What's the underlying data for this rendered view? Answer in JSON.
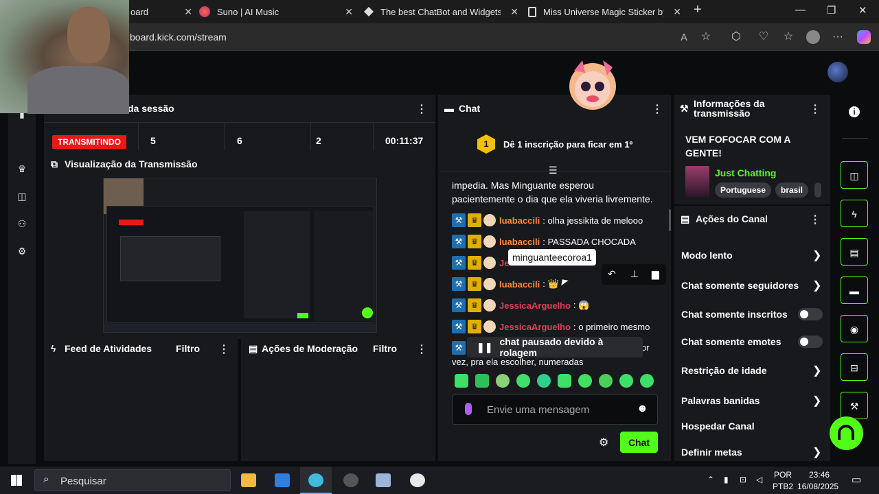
{
  "browser": {
    "tabs": [
      {
        "title": "oard",
        "icon": "kick-icon"
      },
      {
        "title": "Suno | AI Music",
        "icon": "suno-icon"
      },
      {
        "title": "The best ChatBot and Widgets fo",
        "icon": "botrix-icon"
      },
      {
        "title": "Miss Universe Magic Sticker by ch",
        "icon": "doc-icon"
      }
    ],
    "url": "board.kick.com/stream"
  },
  "session": {
    "title": "da sessão",
    "status": "TRANSMITINDO",
    "stats": [
      "5",
      "6",
      "2",
      "00:11:37"
    ]
  },
  "preview": {
    "title": "Visualização da Transmissão"
  },
  "activity": {
    "title": "Feed de Atividades",
    "filter": "Filtro"
  },
  "moderation": {
    "title": "Ações de Moderação",
    "filter": "Filtro"
  },
  "chat": {
    "title": "Chat",
    "pinned_badge": "1",
    "pinned_text": "Dê 1 inscrição para ficar em 1º",
    "story_line1": "impedia. Mas Minguante esperou",
    "story_line2": "pacientemente o dia que ela viveria livremente.",
    "messages": [
      {
        "user": "luabaccili",
        "text": ": olha jessikita de melooo",
        "color": "#ff8a3d"
      },
      {
        "user": "luabaccili",
        "text": ": PASSADA CHOCADA",
        "color": "#ff8a3d"
      },
      {
        "user": "Je",
        "text": "",
        "color": "#e23a5c"
      },
      {
        "user": "luabaccili",
        "text": ": 👑",
        "color": "#ff8a3d"
      },
      {
        "user": "JessicaArguelho",
        "text": ": 😱",
        "color": "#e23a5c"
      },
      {
        "user": "JessicaArguelho",
        "text": ": o primeiro mesmo",
        "color": "#e23a5c"
      }
    ],
    "partial_line1_end": "or",
    "partial_line2": "vez, pra ela escolher, numeradas",
    "tooltip": "minguanteecoroa1",
    "paused": "chat pausado devido à rolagem",
    "input_placeholder": "Envie uma mensagem",
    "send_label": "Chat"
  },
  "stream_info": {
    "title": "Informações da transmissão",
    "stream_title": "VEM FOFOCAR COM A GENTE!",
    "category": "Just Chatting",
    "tags": [
      "Portuguese",
      "brasil"
    ]
  },
  "channel_actions": {
    "title": "Ações do Canal",
    "items": [
      {
        "label": "Modo lento",
        "control": "chevron"
      },
      {
        "label": "Chat somente seguidores",
        "control": "chevron"
      },
      {
        "label": "Chat somente inscritos",
        "control": "toggle",
        "on": false
      },
      {
        "label": "Chat somente emotes",
        "control": "toggle",
        "on": false
      },
      {
        "label": "Restrição de idade",
        "control": "chevron"
      },
      {
        "label": "Palavras banidas",
        "control": "chevron"
      },
      {
        "label": "Hospedar Canal",
        "control": "none"
      },
      {
        "label": "Definir metas",
        "control": "chevron"
      }
    ]
  },
  "taskbar": {
    "search": "Pesquisar",
    "lang1": "POR",
    "lang2": "PTB2",
    "time": "23:46",
    "date": "16/08/2025"
  },
  "colors": {
    "accent": "#53fc18",
    "live": "#e91916",
    "panel": "#18191c"
  }
}
